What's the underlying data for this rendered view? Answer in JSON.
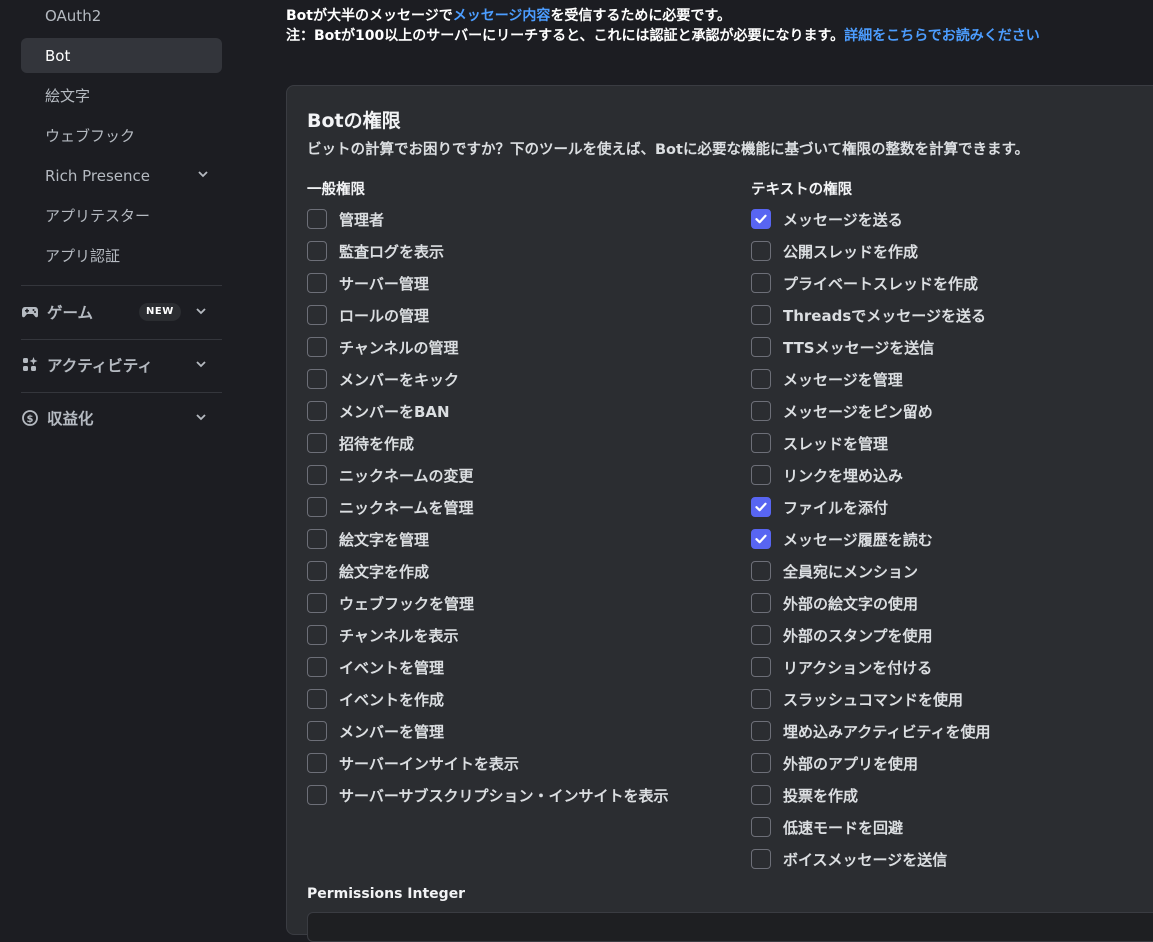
{
  "sidebar": {
    "items": [
      {
        "label": "OAuth2"
      },
      {
        "label": "Bot"
      },
      {
        "label": "絵文字"
      },
      {
        "label": "ウェブフック"
      },
      {
        "label": "Rich Presence"
      },
      {
        "label": "アプリテスター"
      },
      {
        "label": "アプリ認証"
      }
    ],
    "sections": [
      {
        "label": "ゲーム",
        "badge": "NEW",
        "icon": "gamepad-icon"
      },
      {
        "label": "アクティビティ",
        "icon": "activity-icon"
      },
      {
        "label": "収益化",
        "icon": "monetization-icon"
      }
    ]
  },
  "notice": {
    "line1_pre": "Botが大半のメッセージで",
    "line1_link": "メッセージ内容",
    "line1_post": "を受信するために必要です。",
    "line2_pre": "注：Botが100以上のサーバーにリーチすると、これには認証と承認が必要になります。",
    "line2_link": "詳細をこちらでお読みください"
  },
  "panel": {
    "title": "Botの権限",
    "subtitle": "ビットの計算でお困りですか？下のツールを使えば、Botに必要な機能に基づいて権限の整数を計算できます。",
    "permissions_integer_label": "Permissions Integer"
  },
  "general": {
    "title": "一般権限",
    "items": [
      {
        "label": "管理者",
        "checked": false
      },
      {
        "label": "監査ログを表示",
        "checked": false
      },
      {
        "label": "サーバー管理",
        "checked": false
      },
      {
        "label": "ロールの管理",
        "checked": false
      },
      {
        "label": "チャンネルの管理",
        "checked": false
      },
      {
        "label": "メンバーをキック",
        "checked": false
      },
      {
        "label": "メンバーをBAN",
        "checked": false
      },
      {
        "label": "招待を作成",
        "checked": false
      },
      {
        "label": "ニックネームの変更",
        "checked": false
      },
      {
        "label": "ニックネームを管理",
        "checked": false
      },
      {
        "label": "絵文字を管理",
        "checked": false
      },
      {
        "label": "絵文字を作成",
        "checked": false
      },
      {
        "label": "ウェブフックを管理",
        "checked": false
      },
      {
        "label": "チャンネルを表示",
        "checked": false
      },
      {
        "label": "イベントを管理",
        "checked": false
      },
      {
        "label": "イベントを作成",
        "checked": false
      },
      {
        "label": "メンバーを管理",
        "checked": false
      },
      {
        "label": "サーバーインサイトを表示",
        "checked": false
      },
      {
        "label": "サーバーサブスクリプション・インサイトを表示",
        "checked": false
      }
    ]
  },
  "text": {
    "title": "テキストの権限",
    "items": [
      {
        "label": "メッセージを送る",
        "checked": true
      },
      {
        "label": "公開スレッドを作成",
        "checked": false
      },
      {
        "label": "プライベートスレッドを作成",
        "checked": false
      },
      {
        "label": "Threadsでメッセージを送る",
        "checked": false
      },
      {
        "label": "TTSメッセージを送信",
        "checked": false
      },
      {
        "label": "メッセージを管理",
        "checked": false
      },
      {
        "label": "メッセージをピン留め",
        "checked": false
      },
      {
        "label": "スレッドを管理",
        "checked": false
      },
      {
        "label": "リンクを埋め込み",
        "checked": false
      },
      {
        "label": "ファイルを添付",
        "checked": true
      },
      {
        "label": "メッセージ履歴を読む",
        "checked": true
      },
      {
        "label": "全員宛にメンション",
        "checked": false
      },
      {
        "label": "外部の絵文字の使用",
        "checked": false
      },
      {
        "label": "外部のスタンプを使用",
        "checked": false
      },
      {
        "label": "リアクションを付ける",
        "checked": false
      },
      {
        "label": "スラッシュコマンドを使用",
        "checked": false
      },
      {
        "label": "埋め込みアクティビティを使用",
        "checked": false
      },
      {
        "label": "外部のアプリを使用",
        "checked": false
      },
      {
        "label": "投票を作成",
        "checked": false
      },
      {
        "label": "低速モードを回避",
        "checked": false
      },
      {
        "label": "ボイスメッセージを送信",
        "checked": false
      }
    ]
  },
  "colors": {
    "accent": "#5865f2",
    "link": "#4c9dff"
  }
}
